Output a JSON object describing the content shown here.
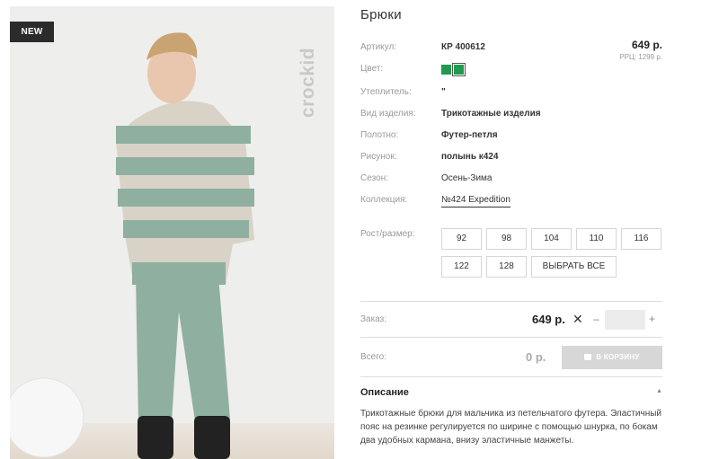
{
  "product": {
    "badge": "NEW",
    "brand_mark": "crockid",
    "title": "Брюки",
    "price": "649 р.",
    "rrc": "РРЦ: 1299 р."
  },
  "attributes": {
    "article": {
      "label": "Артикул:",
      "value": "КР 400612"
    },
    "color": {
      "label": "Цвет:",
      "swatch_color": "#1f9a4f"
    },
    "insulation": {
      "label": "Утеплитель:",
      "value": "\""
    },
    "kind": {
      "label": "Вид изделия:",
      "value": "Трикотажные изделия"
    },
    "fabric": {
      "label": "Полотно:",
      "value": "Футер-петля"
    },
    "pattern": {
      "label": "Рисунок:",
      "value": "полынь к424"
    },
    "season": {
      "label": "Сезон:",
      "value": "Осень-Зима"
    },
    "collection": {
      "label": "Коллекция:",
      "value": "№424 Expedition"
    }
  },
  "sizes": {
    "label": "Рост/размер:",
    "options": [
      "92",
      "98",
      "104",
      "110",
      "116",
      "122",
      "128"
    ],
    "select_all": "ВЫБРАТЬ ВСЕ"
  },
  "order": {
    "label": "Заказ:",
    "price": "649 р.",
    "times": "✕",
    "minus": "–",
    "plus": "+",
    "qty_value": ""
  },
  "total": {
    "label": "Всего:",
    "value": "0 р.",
    "cart_button": "В КОРЗИНУ"
  },
  "description": {
    "title": "Описание",
    "text": "Трикотажные брюки для мальчика из петельчатого футера. Эластичный пояс на резинке регулируется по ширине с помощью шнурка, по бокам два удобных кармана, внизу эластичные манжеты."
  },
  "colors": {
    "accent_green": "#1f9a4f",
    "disabled_button": "#d7d7d7"
  }
}
